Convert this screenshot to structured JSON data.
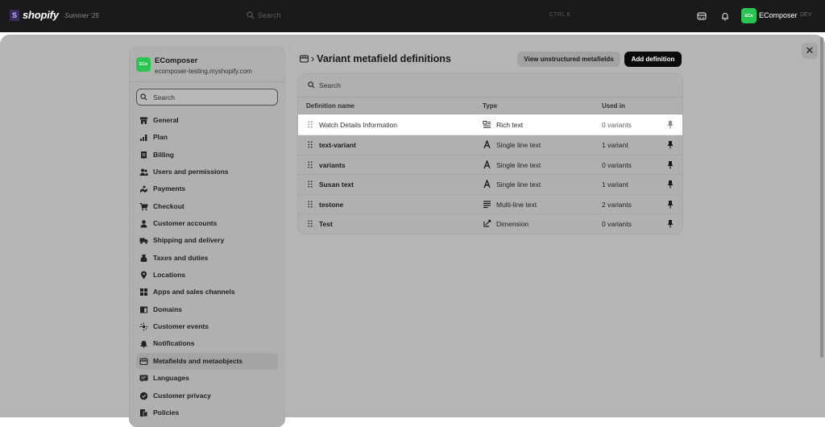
{
  "topbar": {
    "logo_glyph": "S",
    "logo_text": "shopify",
    "edition": "Summer '25",
    "search_placeholder": "Search",
    "shortcut": "CTRL K",
    "store_avatar": "ECo",
    "store_name": "EComposer",
    "store_env": "DEV",
    "icons": [
      "storefront-icon",
      "bell-icon"
    ]
  },
  "sidebar": {
    "avatar": "ECo",
    "store_name": "EComposer",
    "domain": "ecomposer-testing.myshopify.com",
    "search_placeholder": "Search",
    "items": [
      {
        "label": "General",
        "icon": "store-icon"
      },
      {
        "label": "Plan",
        "icon": "chart-icon"
      },
      {
        "label": "Billing",
        "icon": "receipt-icon"
      },
      {
        "label": "Users and permissions",
        "icon": "users-icon"
      },
      {
        "label": "Payments",
        "icon": "payments-icon"
      },
      {
        "label": "Checkout",
        "icon": "cart-icon"
      },
      {
        "label": "Customer accounts",
        "icon": "person-icon"
      },
      {
        "label": "Shipping and delivery",
        "icon": "truck-icon"
      },
      {
        "label": "Taxes and duties",
        "icon": "tax-icon"
      },
      {
        "label": "Locations",
        "icon": "location-icon"
      },
      {
        "label": "Apps and sales channels",
        "icon": "apps-icon"
      },
      {
        "label": "Domains",
        "icon": "globe-icon"
      },
      {
        "label": "Customer events",
        "icon": "events-icon"
      },
      {
        "label": "Notifications",
        "icon": "bell-icon"
      },
      {
        "label": "Metafields and metaobjects",
        "icon": "metafields-icon",
        "active": true
      },
      {
        "label": "Languages",
        "icon": "language-icon"
      },
      {
        "label": "Customer privacy",
        "icon": "privacy-icon"
      },
      {
        "label": "Policies",
        "icon": "policy-icon"
      }
    ]
  },
  "main": {
    "title": "Variant metafield definitions",
    "title_icon": "metafields-icon",
    "view_unstructured_label": "View unstructured metafields",
    "add_definition_label": "Add definition",
    "search_placeholder": "Search",
    "columns": [
      "Definition name",
      "Type",
      "Used in"
    ],
    "rows": [
      {
        "name": "Watch Details Information",
        "type": "Rich text",
        "type_icon": "rich-text-icon",
        "used": "0 variants",
        "highlighted": true
      },
      {
        "name": "text-variant",
        "type": "Single line text",
        "type_icon": "single-line-text-icon",
        "used": "1 variant"
      },
      {
        "name": "variants",
        "type": "Single line text",
        "type_icon": "single-line-text-icon",
        "used": "0 variants"
      },
      {
        "name": "Susan text",
        "type": "Single line text",
        "type_icon": "single-line-text-icon",
        "used": "1 variant"
      },
      {
        "name": "testone",
        "type": "Multi-line text",
        "type_icon": "multi-line-text-icon",
        "used": "2 variants"
      },
      {
        "name": "Test",
        "type": "Dimension",
        "type_icon": "dimension-icon",
        "used": "0 variants"
      }
    ]
  },
  "close_glyph": "✕",
  "colors": {
    "topbar": "#1a1a1a",
    "overlay": "#b5b5b5",
    "accent_green": "#2ac451",
    "primary_button": "#0a0a0a"
  }
}
